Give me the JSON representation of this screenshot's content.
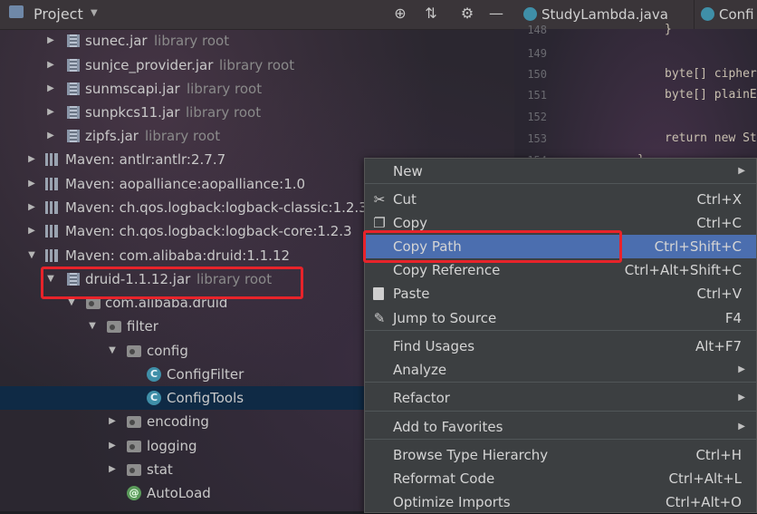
{
  "project_panel": {
    "title": "Project",
    "header_icons": [
      "locate-icon",
      "collapse-icon",
      "gear-icon",
      "minimize-icon"
    ],
    "tree": [
      {
        "label": "sunec.jar",
        "sub": "library root",
        "icon": "jar-icon",
        "arrow": "▶"
      },
      {
        "label": "sunjce_provider.jar",
        "sub": "library root",
        "icon": "jar-icon",
        "arrow": "▶"
      },
      {
        "label": "sunmscapi.jar",
        "sub": "library root",
        "icon": "jar-icon",
        "arrow": "▶"
      },
      {
        "label": "sunpkcs11.jar",
        "sub": "library root",
        "icon": "jar-icon",
        "arrow": "▶"
      },
      {
        "label": "zipfs.jar",
        "sub": "library root",
        "icon": "jar-icon",
        "arrow": "▶"
      },
      {
        "label": "Maven: antlr:antlr:2.7.7",
        "sub": "",
        "icon": "library-icon",
        "arrow": "▶"
      },
      {
        "label": "Maven: aopalliance:aopalliance:1.0",
        "sub": "",
        "icon": "library-icon",
        "arrow": "▶"
      },
      {
        "label": "Maven: ch.qos.logback:logback-classic:1.2.3",
        "sub": "",
        "icon": "library-icon",
        "arrow": "▶"
      },
      {
        "label": "Maven: ch.qos.logback:logback-core:1.2.3",
        "sub": "",
        "icon": "library-icon",
        "arrow": "▶"
      },
      {
        "label": "Maven: com.alibaba:druid:1.1.12",
        "sub": "",
        "icon": "library-icon",
        "arrow": "▼"
      },
      {
        "label": "druid-1.1.12.jar",
        "sub": "library root",
        "icon": "jar-icon",
        "arrow": "▼"
      },
      {
        "label": "com.alibaba.druid",
        "sub": "",
        "icon": "package-icon",
        "arrow": "▼"
      },
      {
        "label": "filter",
        "sub": "",
        "icon": "package-icon",
        "arrow": "▼"
      },
      {
        "label": "config",
        "sub": "",
        "icon": "package-icon",
        "arrow": "▼"
      },
      {
        "label": "ConfigFilter",
        "sub": "",
        "icon": "class-icon",
        "arrow": ""
      },
      {
        "label": "ConfigTools",
        "sub": "",
        "icon": "class-icon",
        "arrow": ""
      },
      {
        "label": "encoding",
        "sub": "",
        "icon": "package-icon",
        "arrow": "▶"
      },
      {
        "label": "logging",
        "sub": "",
        "icon": "package-icon",
        "arrow": "▶"
      },
      {
        "label": "stat",
        "sub": "",
        "icon": "package-icon",
        "arrow": "▶"
      },
      {
        "label": "AutoLoad",
        "sub": "",
        "icon": "annotation-icon",
        "arrow": ""
      }
    ]
  },
  "editor": {
    "tabs": [
      "StudyLambda.java",
      "Confi"
    ],
    "line_numbers": [
      "148",
      "149",
      "150",
      "151",
      "152",
      "153",
      "154"
    ],
    "code_lines": [
      "}",
      "",
      "byte[] cipher",
      "byte[] plainE",
      "",
      "return new St",
      "}"
    ]
  },
  "context_menu": {
    "items": [
      {
        "label": "New",
        "shortcut": "",
        "submenu": true,
        "icon": ""
      },
      {
        "label": "Cut",
        "shortcut": "Ctrl+X",
        "submenu": false,
        "icon": "scissors-icon"
      },
      {
        "label": "Copy",
        "shortcut": "Ctrl+C",
        "submenu": false,
        "icon": "copy-icon"
      },
      {
        "label": "Copy Path",
        "shortcut": "Ctrl+Shift+C",
        "submenu": false,
        "icon": ""
      },
      {
        "label": "Copy Reference",
        "shortcut": "Ctrl+Alt+Shift+C",
        "submenu": false,
        "icon": ""
      },
      {
        "label": "Paste",
        "shortcut": "Ctrl+V",
        "submenu": false,
        "icon": "paste-icon"
      },
      {
        "label": "Jump to Source",
        "shortcut": "F4",
        "submenu": false,
        "icon": "edit-icon"
      },
      {
        "label": "Find Usages",
        "shortcut": "Alt+F7",
        "submenu": false,
        "icon": ""
      },
      {
        "label": "Analyze",
        "shortcut": "",
        "submenu": true,
        "icon": ""
      },
      {
        "label": "Refactor",
        "shortcut": "",
        "submenu": true,
        "icon": ""
      },
      {
        "label": "Add to Favorites",
        "shortcut": "",
        "submenu": true,
        "icon": ""
      },
      {
        "label": "Browse Type Hierarchy",
        "shortcut": "Ctrl+H",
        "submenu": false,
        "icon": ""
      },
      {
        "label": "Reformat Code",
        "shortcut": "Ctrl+Alt+L",
        "submenu": false,
        "icon": ""
      },
      {
        "label": "Optimize Imports",
        "shortcut": "Ctrl+Alt+O",
        "submenu": false,
        "icon": ""
      }
    ],
    "active_item": "Copy Path",
    "submenu_arrow": "▶"
  },
  "colors": {
    "highlight_box": "#e8232a",
    "menu_active": "#4b6eaf",
    "tree_selected": "#0f2a45"
  }
}
